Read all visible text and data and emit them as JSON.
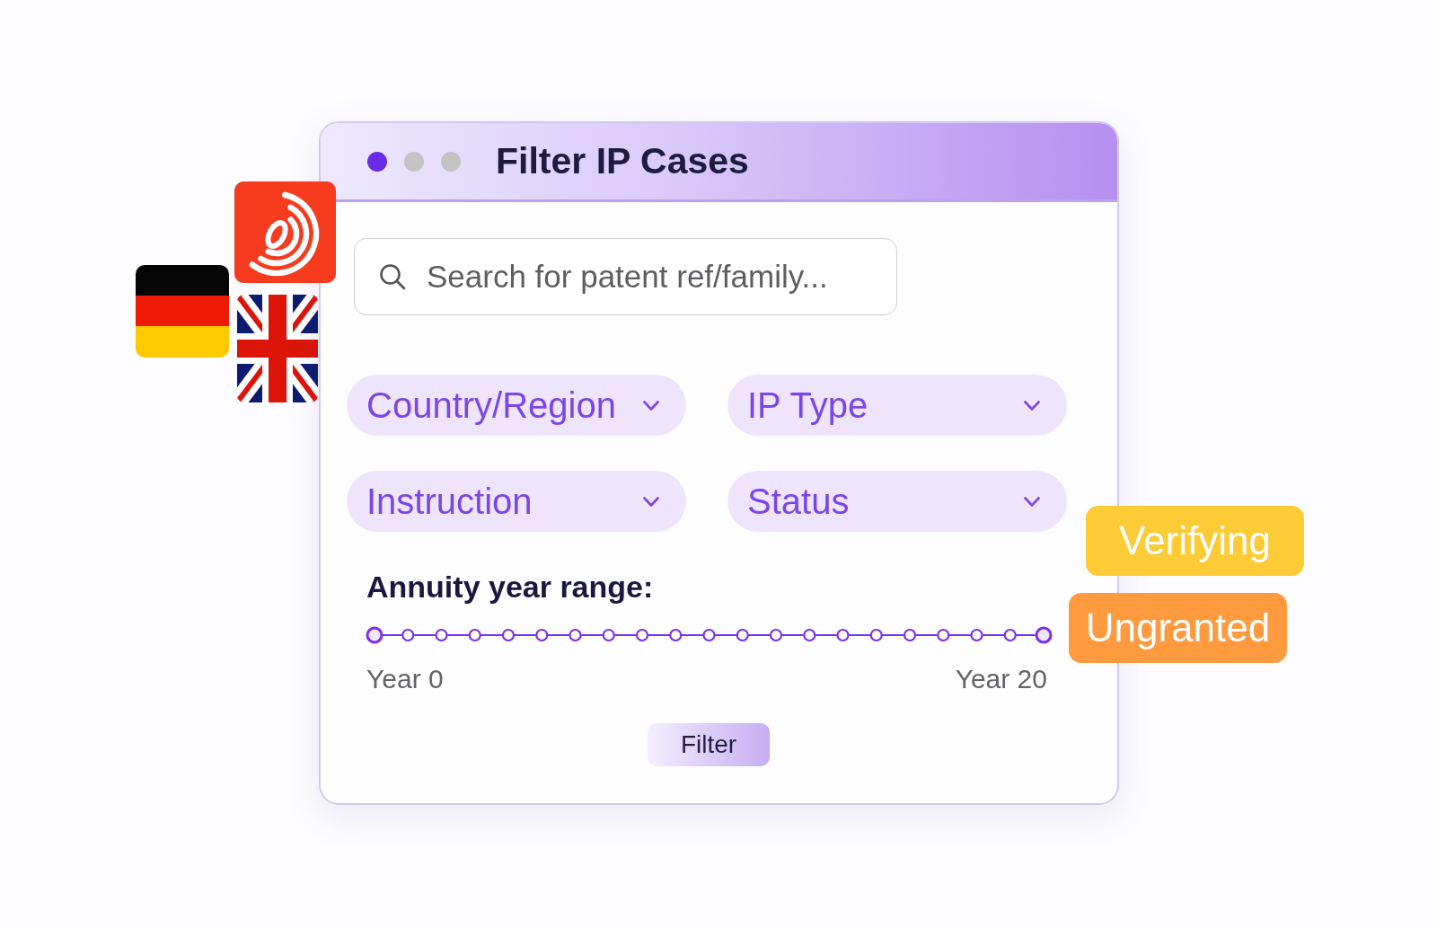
{
  "window": {
    "controls": [
      {
        "color": "#6a2be6"
      },
      {
        "color": "#c3c3c3"
      },
      {
        "color": "#c3c3c3"
      }
    ],
    "title": "Filter IP Cases"
  },
  "search": {
    "placeholder": "Search for patent ref/family..."
  },
  "dropdowns": [
    {
      "label": "Country/Region"
    },
    {
      "label": "IP Type"
    },
    {
      "label": "Instruction"
    },
    {
      "label": "Status"
    }
  ],
  "range": {
    "label": "Annuity year range:",
    "handles": [
      {
        "level": 0
      },
      {
        "level": 1
      }
    ],
    "min_label": "Year 0",
    "max_label": "Year 20"
  },
  "filter_button": {
    "label": "Filter"
  },
  "status_tags": [
    {
      "label": "Verifying",
      "color": "#fccb36"
    },
    {
      "label": "Ungranted",
      "color": "#ff9b3e"
    }
  ]
}
